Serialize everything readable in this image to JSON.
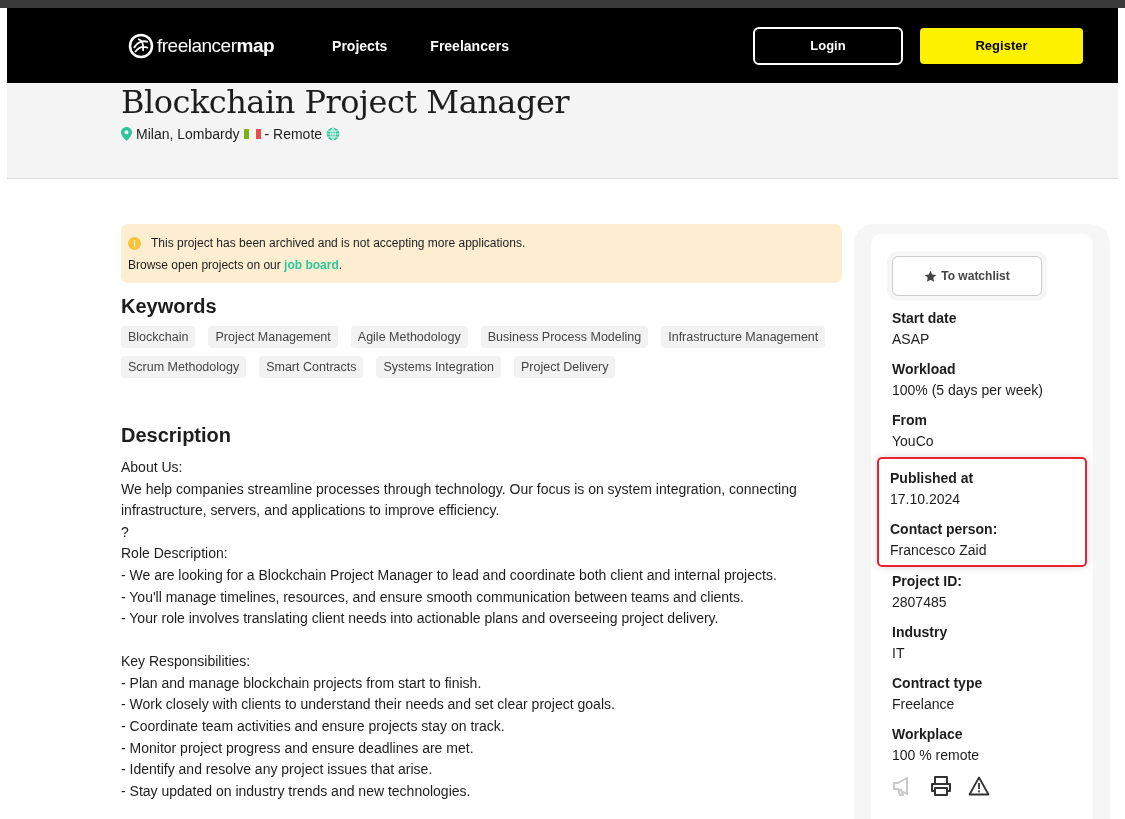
{
  "header": {
    "logo": "freelancer**map**",
    "nav": [
      {
        "label": "Projects"
      },
      {
        "label": "Freelancers"
      }
    ],
    "login": "Login",
    "register": "Register"
  },
  "hero": {
    "title": "Blockchain Project Manager",
    "location": "Milan, Lombardy",
    "remote": "- Remote"
  },
  "notice": {
    "line1": "This project has been archived and is not accepting more applications.",
    "line2": "Browse open projects on our",
    "link": "job board",
    "after": "."
  },
  "keywords": {
    "heading": "Keywords",
    "tags": [
      "Blockchain",
      "Project Management",
      "Agile Methodology",
      "Business Process Modeling",
      "Infrastructure Management",
      "Scrum Methodology",
      "Smart Contracts",
      "Systems Integration",
      "Project Delivery"
    ]
  },
  "description": {
    "heading": "Description",
    "blocks": [
      [
        "About Us:",
        "We help companies streamline processes through technology. Our focus is on system integration, connecting infrastructure, servers, and applications to improve efficiency.",
        "?",
        "Role Description:",
        "- We are looking for a Blockchain Project Manager to lead and coordinate both client and internal projects.",
        "- You'll manage timelines, resources, and ensure smooth communication between teams and clients.",
        "- Your role involves translating client needs into actionable plans and overseeing project delivery."
      ],
      [
        "Key Responsibilities:",
        "- Plan and manage blockchain projects from start to finish.",
        "- Work closely with clients to understand their needs and set clear project goals.",
        "- Coordinate team activities and ensure projects stay on track.",
        "- Monitor project progress and ensure deadlines are met.",
        "- Identify and resolve any project issues that arise.",
        "- Stay updated on industry trends and new technologies."
      ]
    ]
  },
  "sidebar": {
    "watchlist": "To watchlist",
    "facts": [
      {
        "label": "Start date",
        "value": "ASAP",
        "highlighted": false
      },
      {
        "label": "Workload",
        "value": "100% (5 days per week)",
        "highlighted": false
      },
      {
        "label": "From",
        "value": "YouCo",
        "highlighted": false
      },
      {
        "label": "Published at",
        "value": "17.10.2024",
        "highlighted": true
      },
      {
        "label": "Contact person:",
        "value": "Francesco Zaid",
        "highlighted": true
      },
      {
        "label": "Project ID:",
        "value": "2807485",
        "highlighted": false
      },
      {
        "label": "Industry",
        "value": "IT",
        "highlighted": false
      },
      {
        "label": "Contract type",
        "value": "Freelance",
        "highlighted": false
      },
      {
        "label": "Workplace",
        "value": "100 % remote",
        "highlighted": false
      }
    ]
  }
}
